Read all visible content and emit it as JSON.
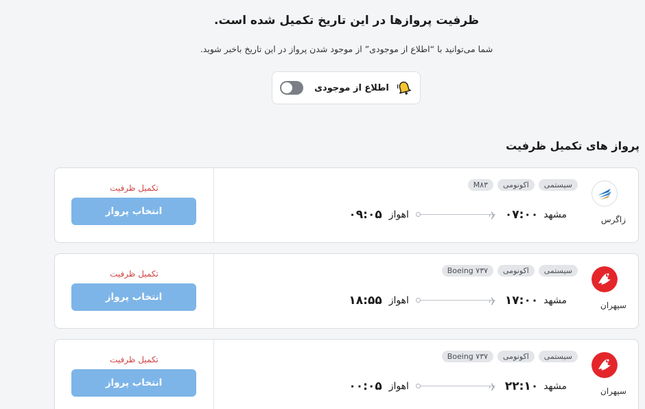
{
  "notice": {
    "heading": "ظرفیت پروازها در این تاریخ تکمیل شده است.",
    "subtext": "شما می‌توانید با “اطلاع از موجودی” از موجود شدن پرواز در این تاریخ باخبر شوید.",
    "notify_label": "اطلاع از موجودی",
    "toggle_on": false,
    "bell_icon": "bell-icon"
  },
  "section_title": "پرواز های تکمیل ظرفیت",
  "flights": [
    {
      "airline": "زاگرس",
      "logo": "zagros-logo",
      "tags": [
        "سیستمی",
        "اکونومی",
        "M۸۳"
      ],
      "origin": "مشهد",
      "depart_time": "۰۷:۰۰",
      "destination": "اهواز",
      "arrive_time": "۰۹:۰۵",
      "status": "تکمیل ظرفیت",
      "button": "انتخاب پرواز"
    },
    {
      "airline": "سپهران",
      "logo": "sepehran-logo",
      "tags": [
        "سیستمی",
        "اکونومی",
        "Boeing ۷۳۷"
      ],
      "origin": "مشهد",
      "depart_time": "۱۷:۰۰",
      "destination": "اهواز",
      "arrive_time": "۱۸:۵۵",
      "status": "تکمیل ظرفیت",
      "button": "انتخاب پرواز"
    },
    {
      "airline": "سپهران",
      "logo": "sepehran-logo",
      "tags": [
        "سیستمی",
        "اکونومی",
        "Boeing ۷۳۷"
      ],
      "origin": "مشهد",
      "depart_time": "۲۲:۱۰",
      "destination": "اهواز",
      "arrive_time": "۰۰:۰۵",
      "status": "تکمیل ظرفیت",
      "button": "انتخاب پرواز"
    }
  ],
  "colors": {
    "accent_button": "#7db5e8",
    "status_red": "#d04444",
    "toggle_off": "#7b7f85",
    "sepehran_red": "#e4262b",
    "zagros_blue": "#1f6fb8"
  }
}
